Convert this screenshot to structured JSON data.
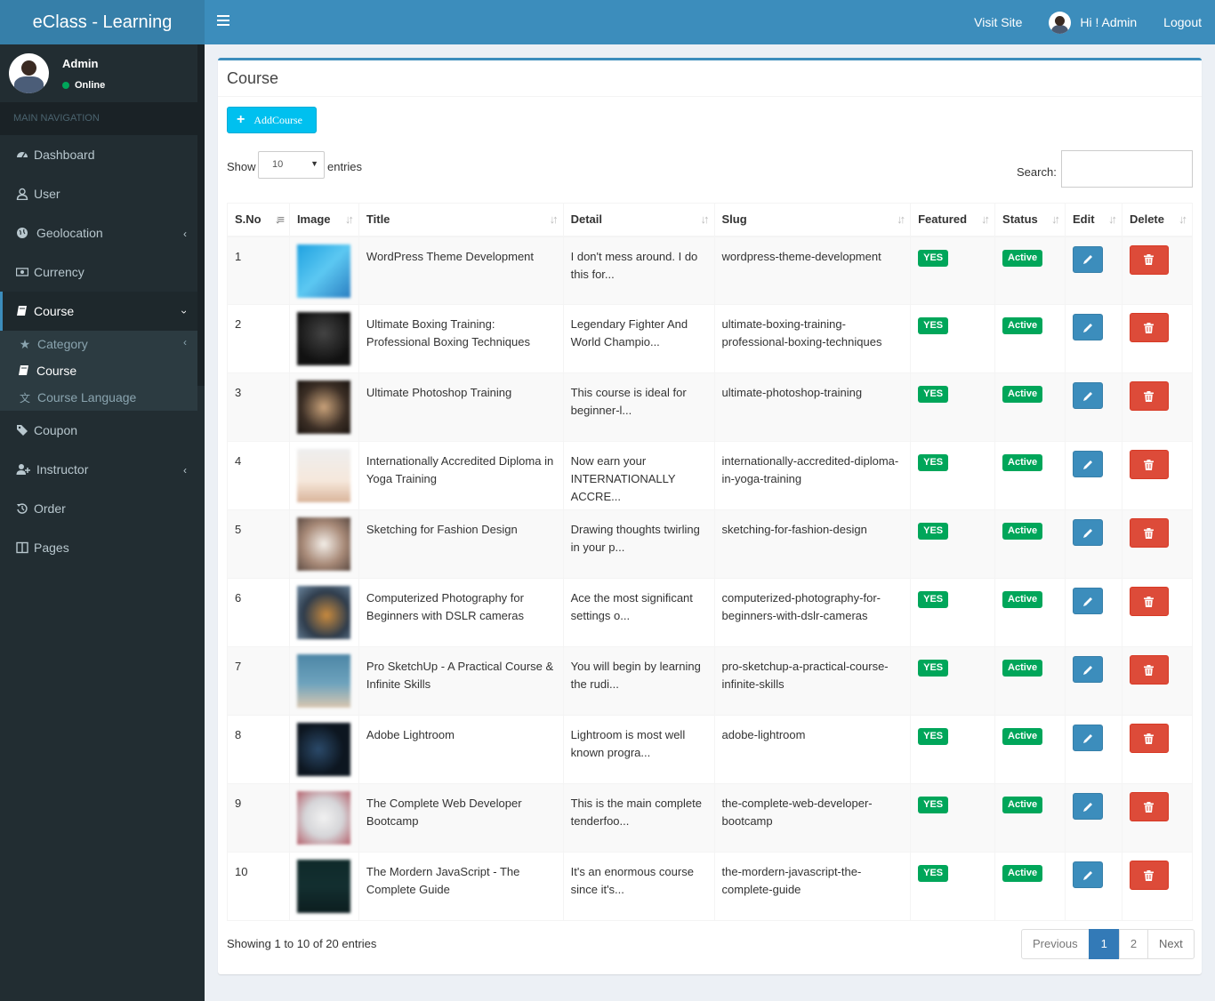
{
  "header": {
    "brand": "eClass - Learning",
    "visit_site": "Visit Site",
    "greeting": "Hi ! Admin",
    "logout": "Logout"
  },
  "sidebar": {
    "user_name": "Admin",
    "user_status": "Online",
    "nav_header": "MAIN NAVIGATION",
    "items": [
      {
        "label": "Dashboard",
        "icon": "dashboard-icon"
      },
      {
        "label": "User",
        "icon": "user-icon"
      },
      {
        "label": "Geolocation",
        "icon": "globe-icon"
      },
      {
        "label": "Currency",
        "icon": "money-icon"
      },
      {
        "label": "Course",
        "icon": "book-icon"
      },
      {
        "label": "Coupon",
        "icon": "tags-icon"
      },
      {
        "label": "Instructor",
        "icon": "user-plus-icon"
      },
      {
        "label": "Order",
        "icon": "history-icon"
      },
      {
        "label": "Pages",
        "icon": "columns-icon"
      }
    ],
    "course_sub": [
      {
        "label": "Category",
        "icon": "star-icon"
      },
      {
        "label": "Course",
        "icon": "book-icon"
      },
      {
        "label": "Course Language",
        "icon": "language-icon"
      }
    ]
  },
  "content": {
    "title": "Course",
    "add_button": "AddCourse",
    "show_label": "Show",
    "page_length": "10",
    "entries_label": "entries",
    "search_label": "Search:",
    "columns": [
      "S.No",
      "Image",
      "Title",
      "Detail",
      "Slug",
      "Featured",
      "Status",
      "Edit",
      "Delete"
    ],
    "rows": [
      {
        "sno": "1",
        "title": "WordPress Theme Development",
        "detail": "I don't mess around. I do this for...",
        "slug": "wordpress-theme-development",
        "featured": "YES",
        "status": "Active"
      },
      {
        "sno": "2",
        "title": "Ultimate Boxing Training: Professional Boxing Techniques",
        "detail": "Legendary Fighter And World Champio...",
        "slug": "ultimate-boxing-training-professional-boxing-techniques",
        "featured": "YES",
        "status": "Active"
      },
      {
        "sno": "3",
        "title": "Ultimate Photoshop Training",
        "detail": "This course is ideal for beginner-l...",
        "slug": "ultimate-photoshop-training",
        "featured": "YES",
        "status": "Active"
      },
      {
        "sno": "4",
        "title": "Internationally Accredited Diploma in Yoga Training",
        "detail": "Now earn your INTERNATIONALLY ACCRE...",
        "slug": "internationally-accredited-diploma-in-yoga-training",
        "featured": "YES",
        "status": "Active"
      },
      {
        "sno": "5",
        "title": "Sketching for Fashion Design",
        "detail": "Drawing thoughts twirling in your p...",
        "slug": "sketching-for-fashion-design",
        "featured": "YES",
        "status": "Active"
      },
      {
        "sno": "6",
        "title": "Computerized Photography for Beginners with DSLR cameras",
        "detail": "Ace the most significant settings o...",
        "slug": "computerized-photography-for-beginners-with-dslr-cameras",
        "featured": "YES",
        "status": "Active"
      },
      {
        "sno": "7",
        "title": "Pro SketchUp - A Practical Course & Infinite Skills",
        "detail": "You will begin by learning the rudi...",
        "slug": "pro-sketchup-a-practical-course-infinite-skills",
        "featured": "YES",
        "status": "Active"
      },
      {
        "sno": "8",
        "title": "Adobe Lightroom",
        "detail": "Lightroom is most well known progra...",
        "slug": "adobe-lightroom",
        "featured": "YES",
        "status": "Active"
      },
      {
        "sno": "9",
        "title": "The Complete Web Developer Bootcamp",
        "detail": "This is the main complete tenderfoo...",
        "slug": "the-complete-web-developer-bootcamp",
        "featured": "YES",
        "status": "Active"
      },
      {
        "sno": "10",
        "title": "The Mordern JavaScript - The Complete Guide",
        "detail": "It's an enormous course since it's...",
        "slug": "the-mordern-javascript-the-complete-guide",
        "featured": "YES",
        "status": "Active"
      }
    ],
    "info": "Showing 1 to 10 of 20 entries",
    "pagination": {
      "previous": "Previous",
      "page1": "1",
      "page2": "2",
      "next": "Next"
    }
  },
  "colors": {
    "header": "#3c8dbc",
    "sidebar": "#222d32",
    "success": "#00a65a",
    "danger": "#dd4b39",
    "info": "#00c0ef"
  }
}
